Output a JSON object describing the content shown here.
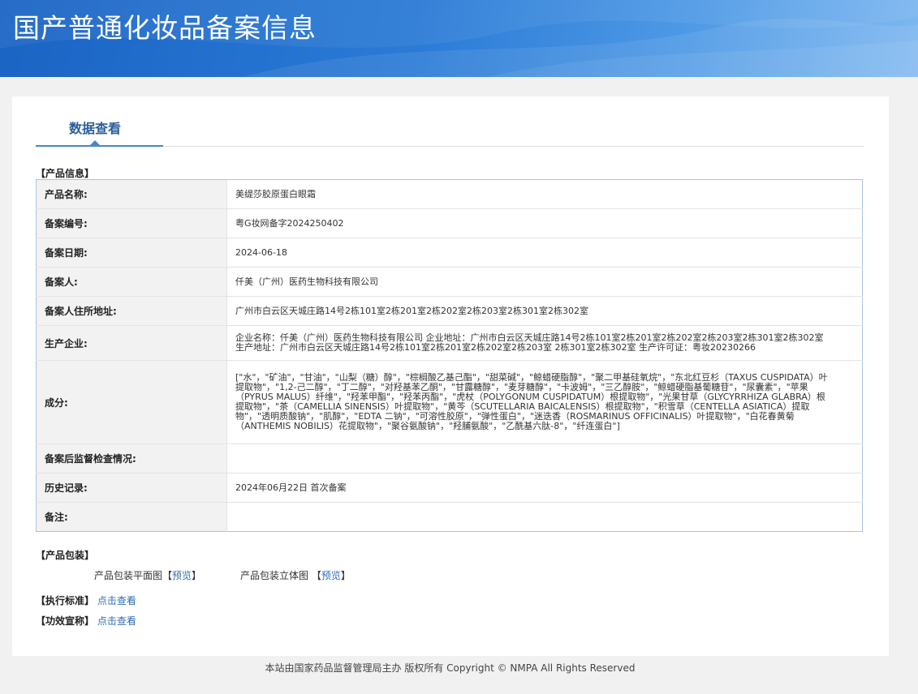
{
  "header": {
    "title": "国产普通化妆品备案信息"
  },
  "tabs": [
    {
      "label": "数据查看"
    }
  ],
  "product_info": {
    "section_title": "【产品信息】",
    "rows": [
      {
        "label": "产品名称:",
        "value": "美缇莎胶原蛋白眼霜"
      },
      {
        "label": "备案编号:",
        "value": "粤G妆网备字2024250402"
      },
      {
        "label": "备案日期:",
        "value": "2024-06-18"
      },
      {
        "label": "备案人:",
        "value": "仟美（广州）医药生物科技有限公司"
      },
      {
        "label": "备案人住所地址:",
        "value": "广州市白云区天城庄路14号2栋101室2栋201室2栋202室2栋203室2栋301室2栋302室"
      },
      {
        "label": "生产企业:",
        "value": "企业名称：仟美（广州）医药生物科技有限公司 企业地址：广州市白云区天城庄路14号2栋101室2栋201室2栋202室2栋203室2栋301室2栋302室 生产地址：广州市白云区天城庄路14号2栋101室2栋201室2栋202室2栋203室 2栋301室2栋302室 生产许可证：粤妆20230266"
      },
      {
        "label": "成分:",
        "value": "[\"水\"，\"矿油\"，\"甘油\"，\"山梨（糖）醇\"，\"棕榈酸乙基己酯\"，\"甜菜碱\"，\"鲸蜡硬脂醇\"，\"聚二甲基硅氧烷\"，\"东北红豆杉（TAXUS CUSPIDATA）叶提取物\"，\"1,2-己二醇\"，\"丁二醇\"，\"对羟基苯乙酮\"，\"甘露糖醇\"，\"麦芽糖醇\"，\"卡波姆\"，\"三乙醇胺\"，\"鲸蜡硬脂基葡糖苷\"，\"尿囊素\"，\"苹果（PYRUS MALUS）纤维\"，\"羟苯甲酯\"，\"羟苯丙酯\"，\"虎杖（POLYGONUM CUSPIDATUM）根提取物\"，\"光果甘草（GLYCYRRHIZA GLABRA）根提取物\"，\"茶（CAMELLIA SINENSIS）叶提取物\"，\"黄芩（SCUTELLARIA BAICALENSIS）根提取物\"，\"积雪草（CENTELLA ASIATICA）提取物\"，\"透明质酸钠\"，\"肌醇\"，\"EDTA 二钠\"，\"可溶性胶原\"，\"弹性蛋白\"，\"迷迭香（ROSMARINUS OFFICINALIS）叶提取物\"，\"白花春黄菊（ANTHEMIS NOBILIS）花提取物\"，\"聚谷氨酸钠\"，\"羟脯氨酸\"，\"乙酰基六肽-8\"，\"纤连蛋白\"]"
      },
      {
        "label": "备案后监督检查情况:",
        "value": ""
      },
      {
        "label": "历史记录:",
        "value": "2024年06月22日 首次备案"
      },
      {
        "label": "备注:",
        "value": ""
      }
    ]
  },
  "packaging": {
    "section_title": "【产品包装】",
    "flat_label": "产品包装平面图",
    "solid_label": "产品包装立体图",
    "open_bracket": "【",
    "close_bracket": "】",
    "preview_link": "预览"
  },
  "standard": {
    "section_title": "【执行标准】",
    "link": "点击查看"
  },
  "efficacy": {
    "section_title": "【功效宣称】",
    "link": "点击查看"
  },
  "footer": {
    "text": "本站由国家药品监督管理局主办 版权所有 Copyright © NMPA All Rights Reserved"
  },
  "colors": {
    "header_blue": "#2a7ad6",
    "link_blue": "#2e6db3",
    "tab_blue": "#2b5d9b"
  }
}
